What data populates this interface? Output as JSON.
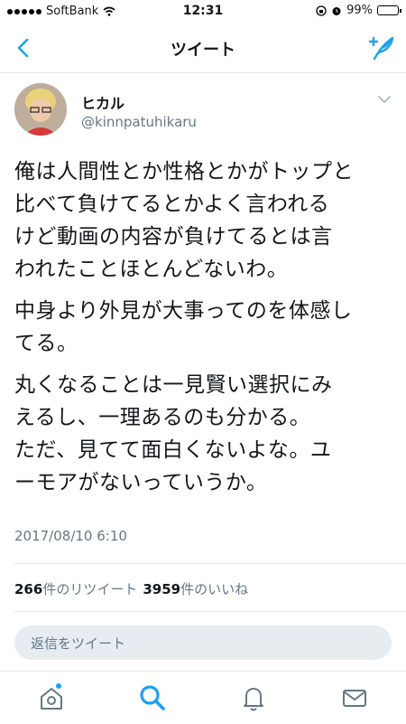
{
  "status_bar": {
    "carrier": "SoftBank",
    "time": "12:31",
    "battery": "99%",
    "battery_level": 0.99
  },
  "nav": {
    "title": "ツイート"
  },
  "tweet": {
    "display_name": "ヒカル",
    "handle": "@kinnpatuhikaru",
    "paragraphs": [
      "俺は人間性とか性格とかがトップと\n比べて負けてるとかよく言われる\nけど動画の内容が負けてるとは言\nわれたことほとんどないわ。",
      "中身より外見が大事ってのを体感し\nてる。",
      "丸くなることは一見賢い選択にみ\nえるし、一理あるのも分かる。\nただ、見てて面白くないよな。ユ\nーモアがないっていうか。"
    ],
    "timestamp": "2017/08/10 6:10"
  },
  "stats": {
    "retweets_count": "266",
    "retweets_label": "件のリツイート",
    "likes_count": "3959",
    "likes_label": "件のいいね"
  },
  "reply": {
    "placeholder": "返信をツイート"
  },
  "tabbar": {
    "items": [
      "home-icon",
      "search-icon",
      "notifications-icon",
      "messages-icon"
    ],
    "active": "search-icon"
  },
  "colors": {
    "accent": "#1da1f2",
    "text": "#14171a",
    "muted": "#657786",
    "divider": "#e1e8ed"
  }
}
